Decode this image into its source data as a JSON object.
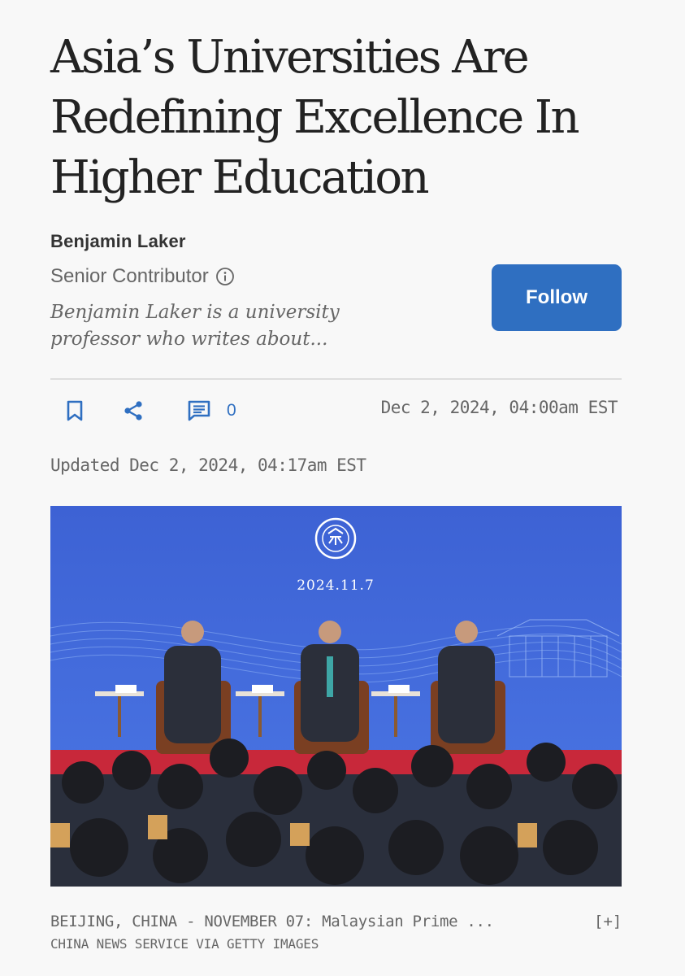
{
  "article": {
    "title": "Asia’s Universities Are Redefining Excellence In Higher Education",
    "author": {
      "name": "Benjamin Laker",
      "role": "Senior Contributor",
      "bio": "Benjamin Laker is a university professor who writes about...",
      "follow_label": "Follow"
    },
    "actions": {
      "bookmark_icon": "bookmark-icon",
      "share_icon": "share-icon",
      "comment_icon": "comment-icon",
      "comment_count": "0"
    },
    "published": "Dec 2, 2024, 04:00am EST",
    "updated": "Updated Dec 2, 2024, 04:17am EST",
    "image": {
      "backdrop_date": "2024.11.7",
      "university_seal_text": "PEKING UNIVERSITY",
      "caption": "BEIJING, CHINA - NOVEMBER 07: Malaysian Prime ...",
      "expand_label": "[+]",
      "credit": "CHINA NEWS SERVICE VIA GETTY IMAGES"
    }
  },
  "colors": {
    "accent": "#2f6fc1",
    "backdrop": "#3c63d2",
    "stage_red": "#c8283a"
  }
}
